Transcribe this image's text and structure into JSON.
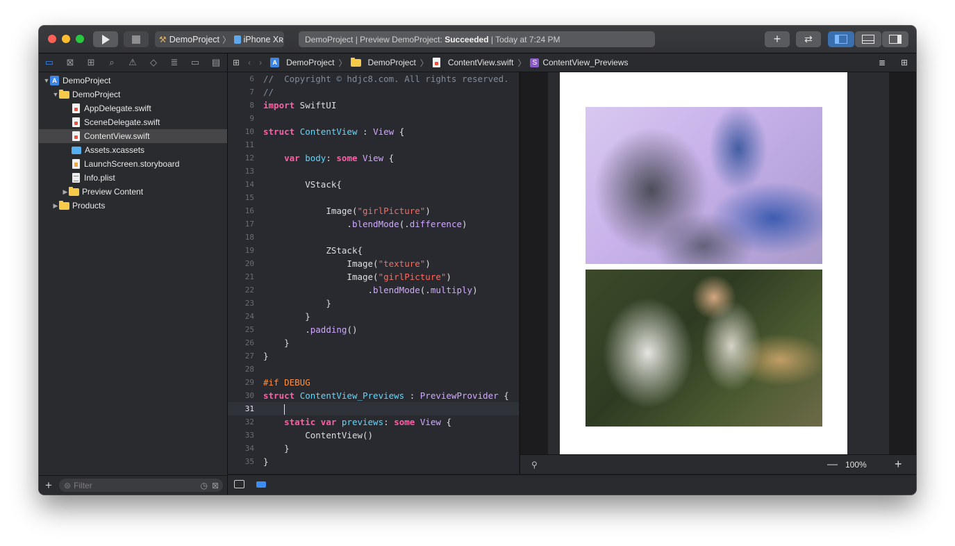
{
  "toolbar": {
    "scheme_name": "DemoProject",
    "device_name": "iPhone Xʀ",
    "activity_prefix": "DemoProject | Preview DemoProject: ",
    "activity_status": "Succeeded",
    "activity_suffix": " | Today at 7:24 PM"
  },
  "navigator": {
    "items": [
      {
        "label": "DemoProject"
      },
      {
        "label": "DemoProject"
      },
      {
        "label": "AppDelegate.swift"
      },
      {
        "label": "SceneDelegate.swift"
      },
      {
        "label": "ContentView.swift"
      },
      {
        "label": "Assets.xcassets"
      },
      {
        "label": "LaunchScreen.storyboard"
      },
      {
        "label": "Info.plist"
      },
      {
        "label": "Preview Content"
      },
      {
        "label": "Products"
      }
    ],
    "filter_placeholder": "Filter"
  },
  "jumpbar": {
    "crumbs": [
      "DemoProject",
      "DemoProject",
      "ContentView.swift",
      "ContentView_Previews"
    ],
    "struct_badge": "S"
  },
  "editor": {
    "line_numbers": [
      "6",
      "7",
      "8",
      "9",
      "10",
      "11",
      "12",
      "13",
      "14",
      "15",
      "16",
      "17",
      "18",
      "19",
      "20",
      "21",
      "22",
      "23",
      "24",
      "25",
      "26",
      "27",
      "28",
      "29",
      "30",
      "31",
      "32",
      "33",
      "34",
      "35"
    ],
    "current_line": "31",
    "tokens": {
      "copyright": "//  Copyright © hdjc8.com. All rights reserved.",
      "import": "import",
      "swiftui": " SwiftUI",
      "struct": "struct",
      "contentview": "ContentView",
      "colon_view": " : ",
      "view": "View",
      "open_brace": " {",
      "var": "var",
      "body": "body",
      "colon": ": ",
      "some": "some",
      "vstack": "VStack{",
      "image": "Image(",
      "girlpicture": "\"girlPicture\"",
      "close_paren": ")",
      "dot": ".",
      "blendmode": "blendMode",
      "paren_dot": "(.",
      "difference": "difference",
      "multiply": "multiply",
      "zstack": "ZStack{",
      "texture": "\"texture\"",
      "close_brace": "}",
      "padding": "padding",
      "parens": "()",
      "if_debug": "#if DEBUG",
      "previews_struct": "ContentView_Previews",
      "previewprovider": "PreviewProvider",
      "static": "static",
      "previews": "previews",
      "contentview_call": "ContentView()"
    }
  },
  "canvas": {
    "zoom": "100%"
  },
  "colors": {
    "keyword": "#fc5fa3",
    "type": "#5dd8ff",
    "string": "#fc6a5d",
    "comment": "#7f8c98",
    "accent": "#3c8cf2"
  }
}
